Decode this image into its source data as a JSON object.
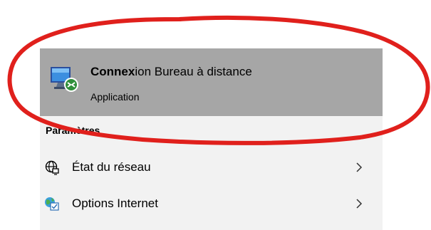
{
  "best_match": {
    "title_bold": "Connex",
    "title_rest": "ion Bureau à distance",
    "subtitle": "Application",
    "icon": "remote-desktop-icon"
  },
  "settings": {
    "header": "Paramètres",
    "items": [
      {
        "label": "État du réseau",
        "icon": "network-globe-icon",
        "chevron": "chevron-right-icon"
      },
      {
        "label": "Options Internet",
        "icon": "internet-options-icon",
        "chevron": "chevron-right-icon"
      }
    ]
  },
  "colors": {
    "panel_background": "#f2f2f2",
    "selected_background": "#a6a6a6",
    "annotation_red": "#e0201c",
    "text": "#000000"
  }
}
